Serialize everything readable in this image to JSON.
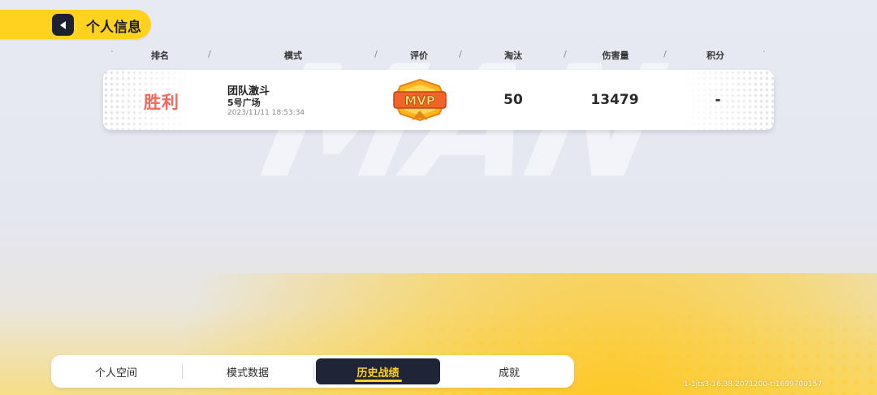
{
  "header": {
    "title": "个人信息",
    "back_icon": "back-arrow-icon"
  },
  "columns": {
    "rank": "排名",
    "mode": "模式",
    "rating": "评价",
    "eliminations": "淘汰",
    "damage": "伤害量",
    "points": "积分",
    "separator": "/"
  },
  "records": [
    {
      "result": "胜利",
      "mode_name": "团队激斗",
      "map_name": "5号广场",
      "timestamp": "2023/11/11 18:53:34",
      "rating_badge": "MVP",
      "eliminations": "50",
      "damage": "13479",
      "points": "-"
    }
  ],
  "tabs": [
    {
      "label": "个人空间",
      "active": false
    },
    {
      "label": "模式数据",
      "active": false
    },
    {
      "label": "历史战绩",
      "active": true
    },
    {
      "label": "成就",
      "active": false
    }
  ],
  "version_text": "1-1jts3-16.38.2071200-t:1699700157",
  "colors": {
    "accent": "#ffd21f",
    "dark": "#1f2436",
    "victory": "#f06a5a",
    "mvp_orange": "#f07a18"
  }
}
